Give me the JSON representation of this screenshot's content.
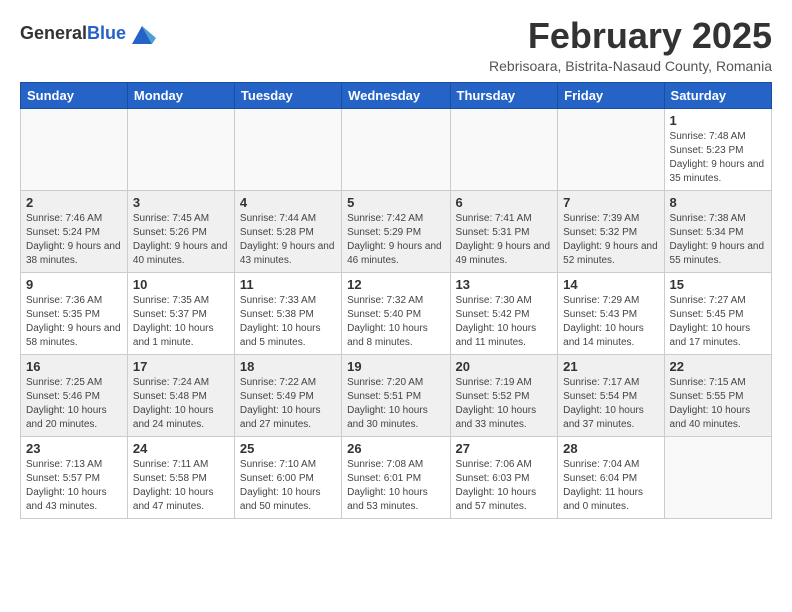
{
  "header": {
    "logo_general": "General",
    "logo_blue": "Blue",
    "month_title": "February 2025",
    "subtitle": "Rebrisoara, Bistrita-Nasaud County, Romania"
  },
  "calendar": {
    "days_of_week": [
      "Sunday",
      "Monday",
      "Tuesday",
      "Wednesday",
      "Thursday",
      "Friday",
      "Saturday"
    ],
    "weeks": [
      [
        {
          "day": "",
          "info": ""
        },
        {
          "day": "",
          "info": ""
        },
        {
          "day": "",
          "info": ""
        },
        {
          "day": "",
          "info": ""
        },
        {
          "day": "",
          "info": ""
        },
        {
          "day": "",
          "info": ""
        },
        {
          "day": "1",
          "info": "Sunrise: 7:48 AM\nSunset: 5:23 PM\nDaylight: 9 hours and 35 minutes."
        }
      ],
      [
        {
          "day": "2",
          "info": "Sunrise: 7:46 AM\nSunset: 5:24 PM\nDaylight: 9 hours and 38 minutes."
        },
        {
          "day": "3",
          "info": "Sunrise: 7:45 AM\nSunset: 5:26 PM\nDaylight: 9 hours and 40 minutes."
        },
        {
          "day": "4",
          "info": "Sunrise: 7:44 AM\nSunset: 5:28 PM\nDaylight: 9 hours and 43 minutes."
        },
        {
          "day": "5",
          "info": "Sunrise: 7:42 AM\nSunset: 5:29 PM\nDaylight: 9 hours and 46 minutes."
        },
        {
          "day": "6",
          "info": "Sunrise: 7:41 AM\nSunset: 5:31 PM\nDaylight: 9 hours and 49 minutes."
        },
        {
          "day": "7",
          "info": "Sunrise: 7:39 AM\nSunset: 5:32 PM\nDaylight: 9 hours and 52 minutes."
        },
        {
          "day": "8",
          "info": "Sunrise: 7:38 AM\nSunset: 5:34 PM\nDaylight: 9 hours and 55 minutes."
        }
      ],
      [
        {
          "day": "9",
          "info": "Sunrise: 7:36 AM\nSunset: 5:35 PM\nDaylight: 9 hours and 58 minutes."
        },
        {
          "day": "10",
          "info": "Sunrise: 7:35 AM\nSunset: 5:37 PM\nDaylight: 10 hours and 1 minute."
        },
        {
          "day": "11",
          "info": "Sunrise: 7:33 AM\nSunset: 5:38 PM\nDaylight: 10 hours and 5 minutes."
        },
        {
          "day": "12",
          "info": "Sunrise: 7:32 AM\nSunset: 5:40 PM\nDaylight: 10 hours and 8 minutes."
        },
        {
          "day": "13",
          "info": "Sunrise: 7:30 AM\nSunset: 5:42 PM\nDaylight: 10 hours and 11 minutes."
        },
        {
          "day": "14",
          "info": "Sunrise: 7:29 AM\nSunset: 5:43 PM\nDaylight: 10 hours and 14 minutes."
        },
        {
          "day": "15",
          "info": "Sunrise: 7:27 AM\nSunset: 5:45 PM\nDaylight: 10 hours and 17 minutes."
        }
      ],
      [
        {
          "day": "16",
          "info": "Sunrise: 7:25 AM\nSunset: 5:46 PM\nDaylight: 10 hours and 20 minutes."
        },
        {
          "day": "17",
          "info": "Sunrise: 7:24 AM\nSunset: 5:48 PM\nDaylight: 10 hours and 24 minutes."
        },
        {
          "day": "18",
          "info": "Sunrise: 7:22 AM\nSunset: 5:49 PM\nDaylight: 10 hours and 27 minutes."
        },
        {
          "day": "19",
          "info": "Sunrise: 7:20 AM\nSunset: 5:51 PM\nDaylight: 10 hours and 30 minutes."
        },
        {
          "day": "20",
          "info": "Sunrise: 7:19 AM\nSunset: 5:52 PM\nDaylight: 10 hours and 33 minutes."
        },
        {
          "day": "21",
          "info": "Sunrise: 7:17 AM\nSunset: 5:54 PM\nDaylight: 10 hours and 37 minutes."
        },
        {
          "day": "22",
          "info": "Sunrise: 7:15 AM\nSunset: 5:55 PM\nDaylight: 10 hours and 40 minutes."
        }
      ],
      [
        {
          "day": "23",
          "info": "Sunrise: 7:13 AM\nSunset: 5:57 PM\nDaylight: 10 hours and 43 minutes."
        },
        {
          "day": "24",
          "info": "Sunrise: 7:11 AM\nSunset: 5:58 PM\nDaylight: 10 hours and 47 minutes."
        },
        {
          "day": "25",
          "info": "Sunrise: 7:10 AM\nSunset: 6:00 PM\nDaylight: 10 hours and 50 minutes."
        },
        {
          "day": "26",
          "info": "Sunrise: 7:08 AM\nSunset: 6:01 PM\nDaylight: 10 hours and 53 minutes."
        },
        {
          "day": "27",
          "info": "Sunrise: 7:06 AM\nSunset: 6:03 PM\nDaylight: 10 hours and 57 minutes."
        },
        {
          "day": "28",
          "info": "Sunrise: 7:04 AM\nSunset: 6:04 PM\nDaylight: 11 hours and 0 minutes."
        },
        {
          "day": "",
          "info": ""
        }
      ]
    ],
    "shaded_rows": [
      1,
      3
    ]
  }
}
